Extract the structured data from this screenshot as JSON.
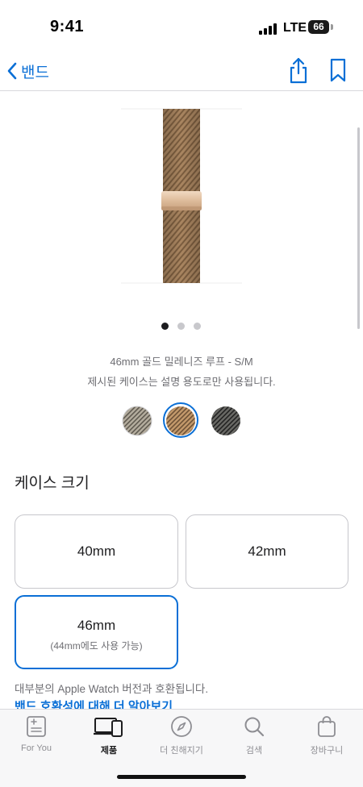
{
  "status_bar": {
    "time": "9:41",
    "network": "LTE",
    "battery": "66"
  },
  "nav": {
    "back_label": "밴드",
    "back_icon": "chevron-left-icon",
    "share_icon": "share-icon",
    "bookmark_icon": "bookmark-icon"
  },
  "gallery": {
    "page_count": 3,
    "current_page": 1
  },
  "product": {
    "name": "46mm 골드 밀레니즈 루프 - S/M",
    "case_note": "제시된 케이스는 설명 용도로만 사용됩니다."
  },
  "swatches": [
    {
      "name": "natural",
      "color": "#a39d8e",
      "selected": false
    },
    {
      "name": "gold",
      "color": "#b48d62",
      "selected": true
    },
    {
      "name": "slate",
      "color": "#4a4a48",
      "selected": false
    }
  ],
  "case_size": {
    "title": "케이스 크기",
    "options": [
      {
        "label": "40mm",
        "sublabel": "",
        "selected": false
      },
      {
        "label": "42mm",
        "sublabel": "",
        "selected": false
      },
      {
        "label": "46mm",
        "sublabel": "(44mm에도 사용 가능)",
        "selected": true
      }
    ]
  },
  "compatibility": {
    "note": "대부분의 Apple Watch 버전과 호환됩니다.",
    "link": "밴드 호환성에 대해 더 알아보기"
  },
  "tabs": [
    {
      "label": "For You",
      "icon": "for-you-icon",
      "active": false
    },
    {
      "label": "제품",
      "icon": "devices-icon",
      "active": true
    },
    {
      "label": "더 친해지기",
      "icon": "compass-icon",
      "active": false
    },
    {
      "label": "검색",
      "icon": "search-icon",
      "active": false
    },
    {
      "label": "장바구니",
      "icon": "bag-icon",
      "active": false
    }
  ],
  "colors": {
    "accent": "#0a6fd6",
    "text": "#1d1d1f",
    "secondary_text": "#6e6e73",
    "border": "#c7c7cc"
  }
}
